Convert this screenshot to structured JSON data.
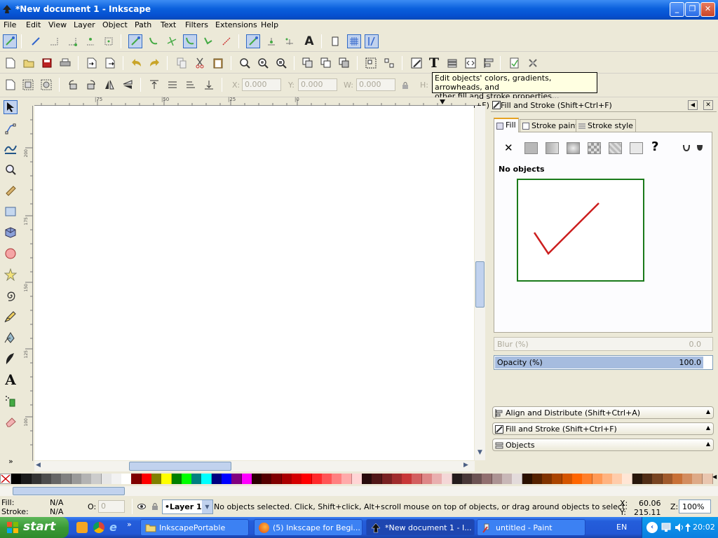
{
  "window": {
    "title": "*New document 1 - Inkscape",
    "buttons": {
      "minimize": "_",
      "maximize": "❐",
      "close": "✕"
    }
  },
  "menu": [
    "File",
    "Edit",
    "View",
    "Layer",
    "Object",
    "Path",
    "Text",
    "Filters",
    "Extensions",
    "Help"
  ],
  "tool_controls": {
    "x_label": "X:",
    "x_value": "0.000",
    "y_label": "Y:",
    "y_value": "0.000",
    "w_label": "W:",
    "w_value": "0.000",
    "h_label": "H:"
  },
  "tooltip": {
    "line1": "Edit objects' colors, gradients, arrowheads, and",
    "line2": "other fill and stroke properties... (Shift+Ctrl+F)"
  },
  "rulers": {
    "horizontal_ticks": [
      "|75",
      "|50",
      "|25",
      "|0"
    ],
    "vertical_ticks": [
      "200",
      "175",
      "150",
      "125",
      "100"
    ]
  },
  "dock": {
    "panel_title": "Fill and Stroke (Shift+Ctrl+F)",
    "tabs": [
      "Fill",
      "Stroke paint",
      "Stroke style"
    ],
    "paint_buttons": [
      "✕",
      "?"
    ],
    "status": "No objects",
    "blur_label": "Blur (%)",
    "blur_value": "0.0",
    "opacity_label": "Opacity (%)",
    "opacity_value": "100.0",
    "collapsed_panels": [
      "Align and Distribute (Shift+Ctrl+A)",
      "Fill and Stroke (Shift+Ctrl+F)",
      "Objects"
    ]
  },
  "statusbar": {
    "fill_label": "Fill:",
    "fill_value": "N/A",
    "stroke_label": "Stroke:",
    "stroke_value": "N/A",
    "opacity_label": "O:",
    "opacity_value": "0",
    "layer": "•Layer 1",
    "message": "No objects selected. Click, Shift+click, Alt+scroll mouse on top of objects, or drag around objects to select.",
    "x_label": "X:",
    "x_value": "60.06",
    "y_label": "Y:",
    "y_value": "215.11",
    "zoom_label": "Z:",
    "zoom_value": "100%"
  },
  "taskbar": {
    "start": "start",
    "tasks": [
      "InkscapePortable",
      "(5) Inkscape for Begi...",
      "*New document 1 - I...",
      "untitled - Paint"
    ],
    "language": "EN",
    "clock": "20:02"
  },
  "colors": {
    "checkmark": "#cc1f1f",
    "preview_border": "#1a7a1a",
    "highlight_box": "#e0141e",
    "xp_blue": "#0a5fdc"
  },
  "palette": [
    "#000000",
    "#1a1a1a",
    "#333333",
    "#4d4d4d",
    "#666666",
    "#808080",
    "#999999",
    "#b3b3b3",
    "#cccccc",
    "#e6e6e6",
    "#f2f2f2",
    "#ffffff",
    "#800000",
    "#ff0000",
    "#808000",
    "#ffff00",
    "#008000",
    "#00ff00",
    "#008080",
    "#00ffff",
    "#000080",
    "#0000ff",
    "#800080",
    "#ff00ff",
    "#2b0000",
    "#550000",
    "#800000",
    "#aa0000",
    "#d40000",
    "#ff0000",
    "#ff2a2a",
    "#ff5555",
    "#ff8080",
    "#ffaaaa",
    "#ffd5d5",
    "#280b0b",
    "#501616",
    "#782121",
    "#a02c2c",
    "#c83737",
    "#d35f5f",
    "#de8787",
    "#e9afaf",
    "#f4d7d7",
    "#241c1c",
    "#483737",
    "#6c5353",
    "#916f6f",
    "#ac9393",
    "#c8b7b7",
    "#e3dbdb",
    "#2b1100",
    "#552200",
    "#803300",
    "#aa4400",
    "#d45500",
    "#ff6600",
    "#ff7f2a",
    "#ff9955",
    "#ffb380",
    "#ffccaa",
    "#ffe6d5",
    "#28170b",
    "#502d16",
    "#784421",
    "#a05a2c",
    "#c87137",
    "#d38d5f",
    "#deaa87",
    "#e9c6af"
  ]
}
